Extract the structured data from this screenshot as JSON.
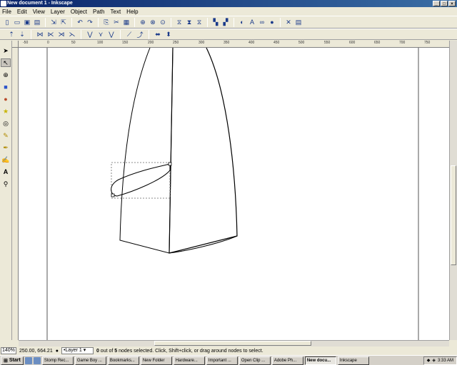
{
  "window": {
    "title": "New document 1 - Inkscape"
  },
  "menu": [
    "File",
    "Edit",
    "View",
    "Layer",
    "Object",
    "Path",
    "Text",
    "Help"
  ],
  "ruler_ticks": [
    "-50",
    "0",
    "50",
    "100",
    "150",
    "200",
    "250",
    "300",
    "350",
    "400",
    "450",
    "500",
    "550",
    "600",
    "650",
    "700",
    "750"
  ],
  "status": {
    "zoom": "140%",
    "coords": "250.00, 664.21",
    "layer": "Layer 1",
    "message_prefix": "0",
    "message_mid": " out of ",
    "message_count": "5",
    "message_suffix": " nodes selected. Click, Shift+click, or drag around nodes to select."
  },
  "taskbar": {
    "start": "Start",
    "tasks": [
      "Stomp Rec...",
      "Game Boy ...",
      "Bookmarks...",
      "New Folder",
      "Hardware...",
      "Important ...",
      "Open Clip ...",
      "Adobe Ph...",
      "New docu...",
      "Inkscape"
    ],
    "clock": "3:33 AM"
  },
  "colors": {
    "titlebar": "#0a246a",
    "canvas": "#ffffff",
    "chrome": "#ece9d8"
  }
}
